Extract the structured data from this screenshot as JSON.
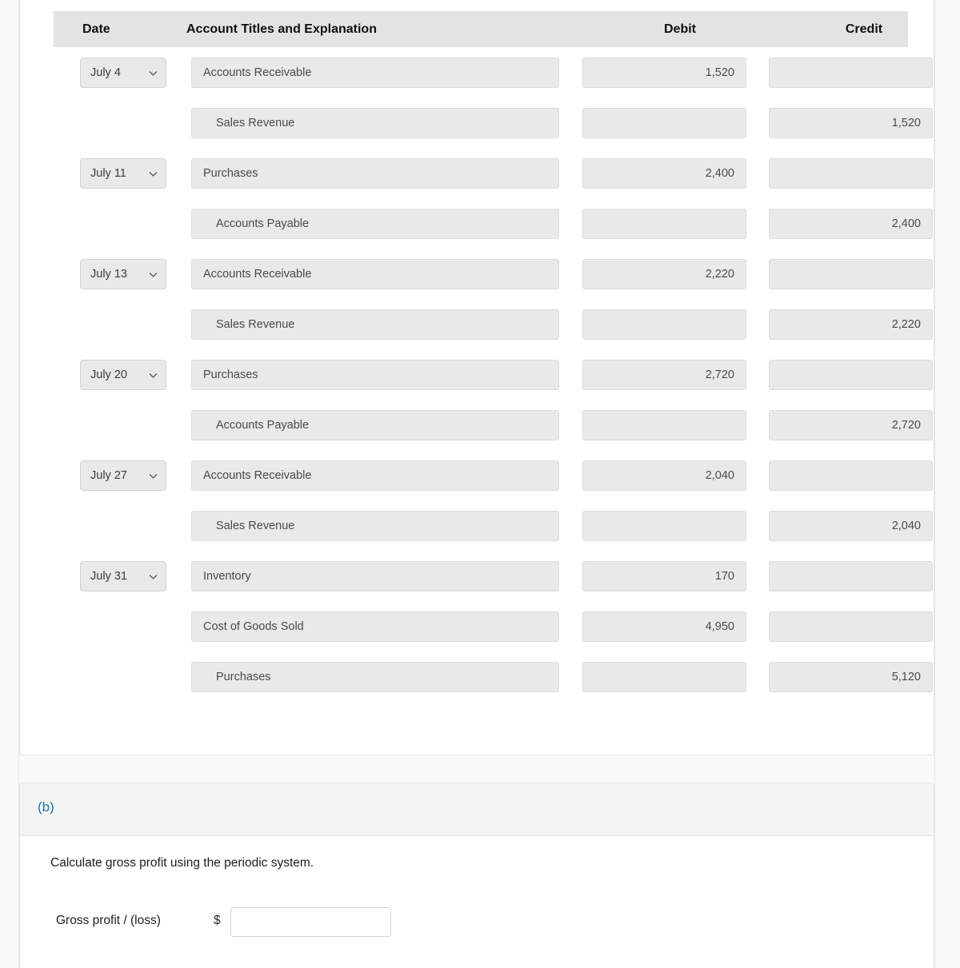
{
  "colors": {
    "accent": "#1f72a8",
    "field_bg": "#e9e9e9",
    "field_border": "#dcdcdc",
    "header_bg": "#e3e3e3",
    "band_bg": "#f4f4f4",
    "page_bg": "#fafafa"
  },
  "journal": {
    "headers": {
      "date": "Date",
      "account": "Account Titles and Explanation",
      "debit": "Debit",
      "credit": "Credit"
    },
    "rows": [
      {
        "date": "July 4",
        "account": "Accounts Receivable",
        "indent": false,
        "debit": "1,520",
        "credit": ""
      },
      {
        "date": "",
        "account": "Sales Revenue",
        "indent": true,
        "debit": "",
        "credit": "1,520"
      },
      {
        "date": "July 11",
        "account": "Purchases",
        "indent": false,
        "debit": "2,400",
        "credit": ""
      },
      {
        "date": "",
        "account": "Accounts Payable",
        "indent": true,
        "debit": "",
        "credit": "2,400"
      },
      {
        "date": "July 13",
        "account": "Accounts Receivable",
        "indent": false,
        "debit": "2,220",
        "credit": ""
      },
      {
        "date": "",
        "account": "Sales Revenue",
        "indent": true,
        "debit": "",
        "credit": "2,220"
      },
      {
        "date": "July 20",
        "account": "Purchases",
        "indent": false,
        "debit": "2,720",
        "credit": ""
      },
      {
        "date": "",
        "account": "Accounts Payable",
        "indent": true,
        "debit": "",
        "credit": "2,720"
      },
      {
        "date": "July 27",
        "account": "Accounts Receivable",
        "indent": false,
        "debit": "2,040",
        "credit": ""
      },
      {
        "date": "",
        "account": "Sales Revenue",
        "indent": true,
        "debit": "",
        "credit": "2,040"
      },
      {
        "date": "July 31",
        "account": "Inventory",
        "indent": false,
        "debit": "170",
        "credit": ""
      },
      {
        "date": "",
        "account": "Cost of Goods Sold",
        "indent": false,
        "debit": "4,950",
        "credit": ""
      },
      {
        "date": "",
        "account": "Purchases",
        "indent": true,
        "debit": "",
        "credit": "5,120"
      }
    ]
  },
  "part_b": {
    "label": "(b)",
    "prompt": "Calculate gross profit using the periodic system.",
    "gross_profit_label": "Gross profit / (loss)",
    "dollar_sign": "$",
    "gross_profit_value": "",
    "gross_profit_placeholder": ""
  }
}
